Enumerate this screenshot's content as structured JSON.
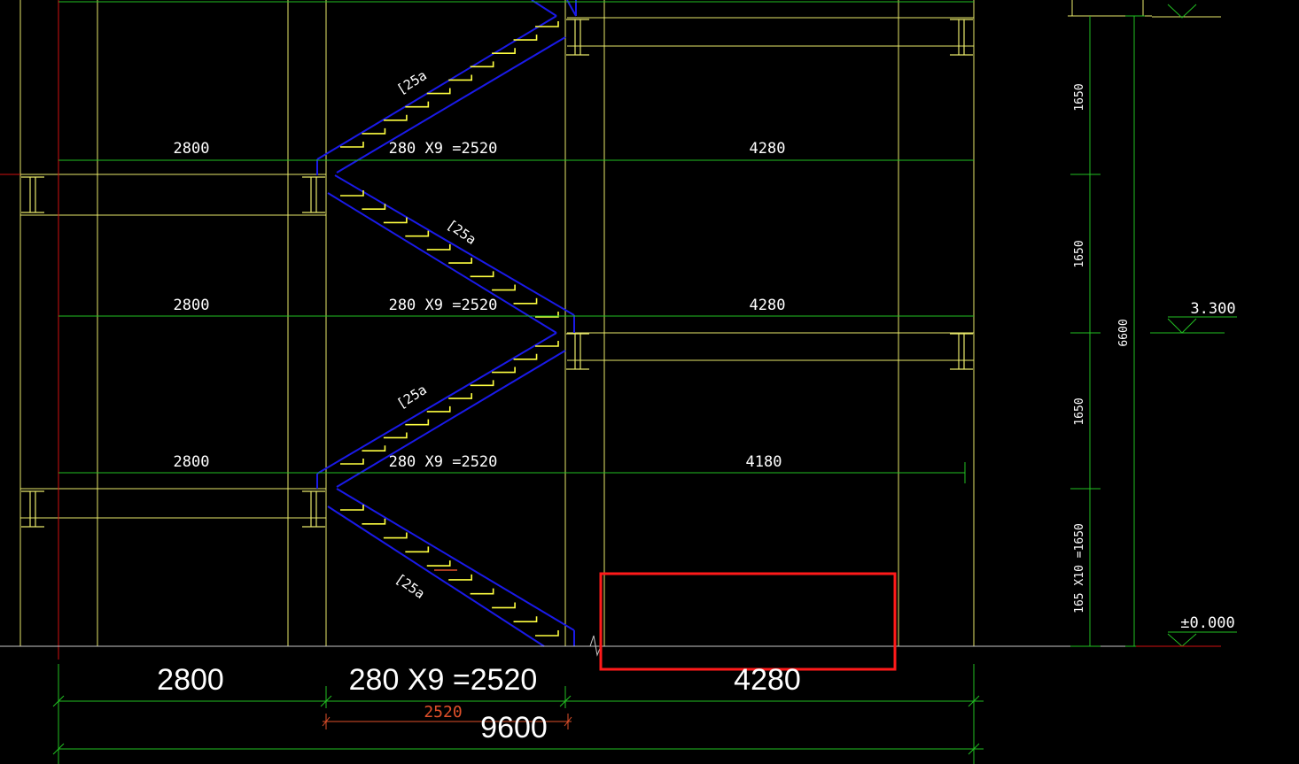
{
  "colors": {
    "background": "#000000",
    "grid": "#e8e86a",
    "dimension": "#22c022",
    "stair": "#1a1ae8",
    "tread": "#ffff40",
    "axis": "#d01010",
    "highlight": "#ff1a1a",
    "ground": "#c8c8c8",
    "redDim": "#e0502a"
  },
  "flights": [
    {
      "left": "2800",
      "stair": "280 X9 =2520",
      "right": "4280",
      "channel": "[25a"
    },
    {
      "left": "2800",
      "stair": "280 X9 =2520",
      "right": "4280",
      "channel": "[25a"
    },
    {
      "left": "2800",
      "stair": "280 X9 =2520",
      "right": "4180",
      "channel": "[25a"
    },
    {
      "channel": "[25a"
    }
  ],
  "bottom": {
    "left": "2800",
    "stair": "280 X9 =2520",
    "right": "4280",
    "red": "2520",
    "total": "9600"
  },
  "vertical": {
    "h1": "1650",
    "h2": "1650",
    "h3": "1650",
    "h4": "165 X10 =1650",
    "total": "6600"
  },
  "elevations": {
    "mid": "3.300",
    "ground": "±0.000"
  }
}
